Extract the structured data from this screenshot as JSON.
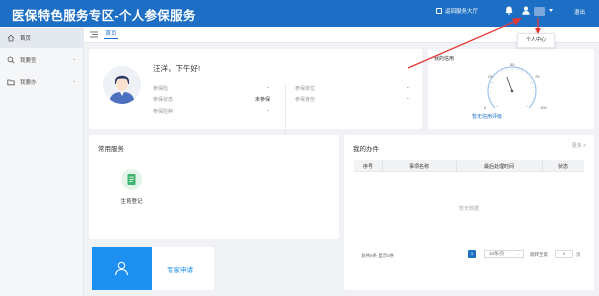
{
  "header": {
    "app_title": "医保特色服务专区-个人参保服务",
    "back_link": "返回服务大厅",
    "logout": "退出",
    "user_menu_tooltip": "个人中心"
  },
  "sidebar": {
    "items": [
      {
        "label": "首页",
        "icon": "home-icon"
      },
      {
        "label": "我要查",
        "icon": "search-icon"
      },
      {
        "label": "我要办",
        "icon": "folder-icon"
      }
    ]
  },
  "tabs": [
    {
      "label": "首页"
    }
  ],
  "profile": {
    "greeting": "汪洋，下午好!",
    "fields": [
      {
        "label": "参保险",
        "value": "-"
      },
      {
        "label": "参保单位",
        "value": "-"
      },
      {
        "label": "参保状态",
        "value": "未参保"
      },
      {
        "label": "参保身份",
        "value": "-"
      },
      {
        "label": "参保险种",
        "value": "-"
      }
    ]
  },
  "credit": {
    "title": "我的信用",
    "gauge_value": 50,
    "gauge_max": 100,
    "ticks": [
      "0",
      "25",
      "50",
      "75",
      "100"
    ],
    "status": "暂无信用评级"
  },
  "services": {
    "title": "常用服务",
    "items": [
      {
        "label": "生育登记",
        "icon": "document-icon"
      }
    ]
  },
  "expert": {
    "label": "专家申请",
    "icon": "user-icon"
  },
  "tasks": {
    "title": "我的办件",
    "more": "更多 >",
    "columns": [
      "序号",
      "事项名称",
      "最后处理时间",
      "状态"
    ],
    "empty_text": "暂无数据",
    "pagination": {
      "summary": "总共0条 显示0条",
      "current_page": "1",
      "per_page": "10条/页",
      "goto_label": "跳转至第",
      "goto_value": "1",
      "goto_suffix": "页"
    }
  },
  "colors": {
    "primary": "#1d6fc5",
    "tile_blue": "#1d8ff0",
    "annotation_red": "#e53935"
  }
}
